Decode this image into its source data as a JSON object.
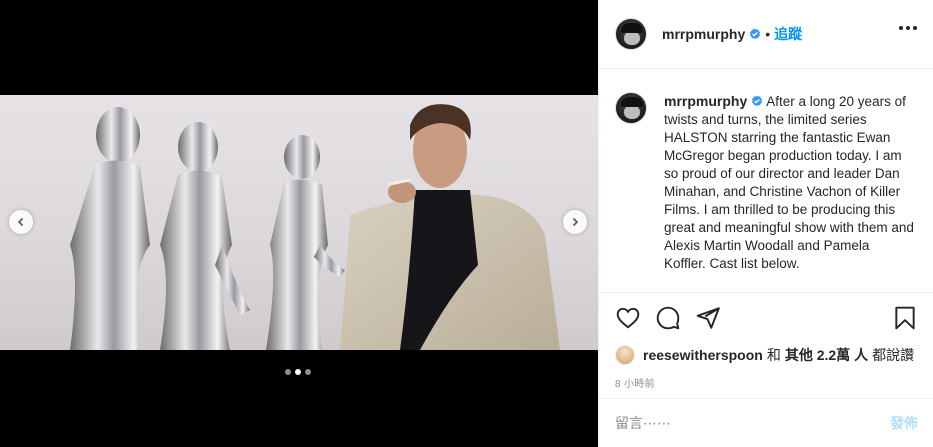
{
  "post": {
    "username": "mrrpmurphy",
    "follow_label": "追蹤",
    "separator": "•",
    "caption": "After a long 20 years of twists and turns, the limited series HALSTON starring the fantastic Ewan McGregor began production today. I am so proud of our director and leader Dan Minahan, and Christine Vachon of Killer Films. I am thrilled to be producing this great and meaningful show with them and Alexis Martin Woodall and Pamela Koffler. Cast list below.",
    "carousel": {
      "slide_count": 3,
      "active_index": 1
    }
  },
  "likes": {
    "user": "reesewitherspoon",
    "and": "和",
    "others_label": "其他 2.2萬 人",
    "suffix": "都說讚"
  },
  "time": "8 小時前",
  "comment": {
    "placeholder": "留言⋯⋯",
    "post_label": "發佈"
  },
  "colors": {
    "accent": "#0095f6",
    "post_disabled": "#b2dffc",
    "verified": "#3897f0",
    "muted": "#8e8e8e"
  },
  "icons": [
    "chevron-left-icon",
    "chevron-right-icon",
    "more-icon",
    "verified-icon",
    "heart-icon",
    "comment-icon",
    "share-icon",
    "bookmark-icon"
  ]
}
